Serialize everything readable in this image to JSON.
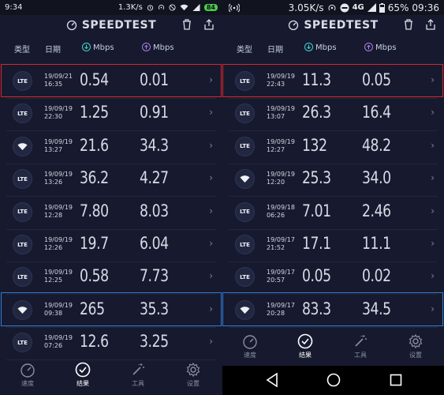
{
  "left": {
    "status": {
      "time": "9:34",
      "speed": "1.3K/s",
      "battery": "84"
    },
    "app_title": "SPEEDTEST",
    "columns": {
      "type": "类型",
      "date": "日期",
      "download_unit": "Mbps",
      "upload_unit": "Mbps"
    },
    "rows": [
      {
        "conn": "LTE",
        "date1": "19/09/21",
        "date2": "16:35",
        "download": "0.54",
        "upload": "0.01"
      },
      {
        "conn": "LTE",
        "date1": "19/09/19",
        "date2": "22:30",
        "download": "1.25",
        "upload": "0.91"
      },
      {
        "conn": "wifi",
        "date1": "19/09/19",
        "date2": "13:27",
        "download": "21.6",
        "upload": "34.3"
      },
      {
        "conn": "LTE",
        "date1": "19/09/19",
        "date2": "13:26",
        "download": "36.2",
        "upload": "4.27"
      },
      {
        "conn": "LTE",
        "date1": "19/09/19",
        "date2": "12:28",
        "download": "7.80",
        "upload": "8.03"
      },
      {
        "conn": "LTE",
        "date1": "19/09/19",
        "date2": "12:26",
        "download": "19.7",
        "upload": "6.04"
      },
      {
        "conn": "LTE",
        "date1": "19/09/19",
        "date2": "12:25",
        "download": "0.58",
        "upload": "7.73"
      },
      {
        "conn": "wifi",
        "date1": "19/09/19",
        "date2": "09:38",
        "download": "265",
        "upload": "35.3"
      },
      {
        "conn": "LTE",
        "date1": "19/09/19",
        "date2": "07:26",
        "download": "12.6",
        "upload": "3.25"
      }
    ],
    "tabs": [
      "速度",
      "结果",
      "工具",
      "设置"
    ]
  },
  "right": {
    "status": {
      "speed": "3.05K/s",
      "network": "4G",
      "battery": "65%",
      "time": "09:36"
    },
    "app_title": "SPEEDTEST",
    "columns": {
      "type": "类型",
      "date": "日期",
      "download_unit": "Mbps",
      "upload_unit": "Mbps"
    },
    "rows": [
      {
        "conn": "LTE",
        "date1": "19/09/19",
        "date2": "22:43",
        "download": "11.3",
        "upload": "0.05"
      },
      {
        "conn": "LTE",
        "date1": "19/09/19",
        "date2": "13:07",
        "download": "26.3",
        "upload": "16.4"
      },
      {
        "conn": "LTE",
        "date1": "19/09/19",
        "date2": "12:27",
        "download": "132",
        "upload": "48.2"
      },
      {
        "conn": "wifi",
        "date1": "19/09/19",
        "date2": "12:20",
        "download": "25.3",
        "upload": "34.0"
      },
      {
        "conn": "LTE",
        "date1": "19/09/18",
        "date2": "06:26",
        "download": "7.01",
        "upload": "2.46"
      },
      {
        "conn": "LTE",
        "date1": "19/09/17",
        "date2": "21:52",
        "download": "17.1",
        "upload": "11.1"
      },
      {
        "conn": "LTE",
        "date1": "19/09/17",
        "date2": "20:57",
        "download": "0.05",
        "upload": "0.02"
      },
      {
        "conn": "wifi",
        "date1": "19/09/17",
        "date2": "20:28",
        "download": "83.3",
        "upload": "34.5"
      }
    ],
    "tabs": [
      "速度",
      "结果",
      "工具",
      "设置"
    ]
  },
  "colors": {
    "highlight_red": "#d7262a",
    "highlight_blue": "#2f7fd8",
    "download_icon": "#3fd3d0",
    "upload_icon": "#a97ce6"
  }
}
